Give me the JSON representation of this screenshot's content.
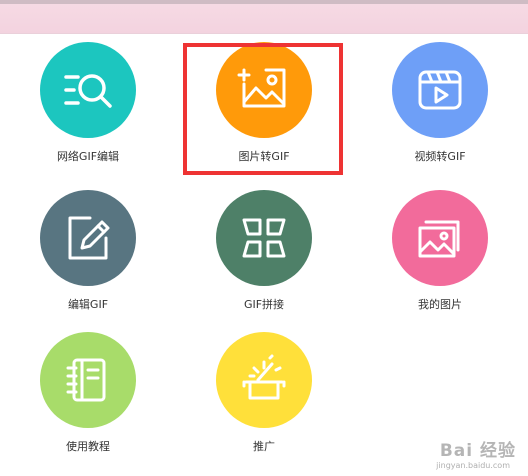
{
  "colors": {
    "header_strip": "#f5d6e1",
    "highlight_border": "#ee3333",
    "teal": "#1cc6bf",
    "orange": "#ff9a0a",
    "blue": "#6e9ff7",
    "slate": "#587581",
    "green": "#4e8068",
    "pink": "#f26b9b",
    "lime": "#a8dc6a",
    "yellow": "#ffe03a"
  },
  "menu": {
    "items": [
      {
        "label": "网络GIF编辑",
        "icon": "search-list-icon"
      },
      {
        "label": "图片转GIF",
        "icon": "image-icon",
        "highlighted": true
      },
      {
        "label": "视频转GIF",
        "icon": "video-play-icon"
      },
      {
        "label": "编辑GIF",
        "icon": "edit-pencil-icon"
      },
      {
        "label": "GIF拼接",
        "icon": "grid-tiles-icon"
      },
      {
        "label": "我的图片",
        "icon": "photo-stack-icon"
      },
      {
        "label": "使用教程",
        "icon": "notebook-icon"
      },
      {
        "label": "推广",
        "icon": "magic-box-icon"
      }
    ]
  },
  "watermark": {
    "text": "Bai 经验",
    "sub": "jingyan.baidu.com"
  }
}
